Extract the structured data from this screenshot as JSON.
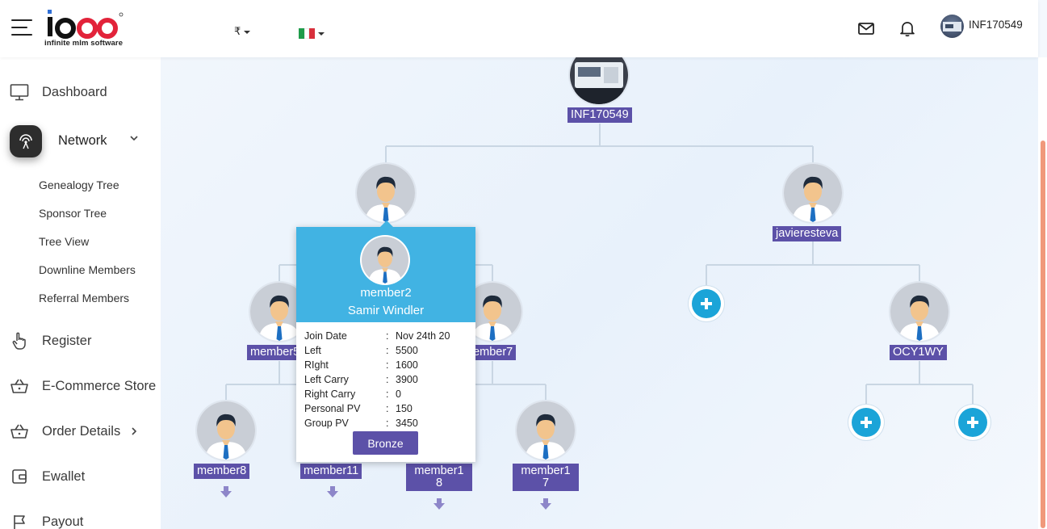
{
  "header": {
    "logo_text": "ioss",
    "logo_tagline": "infinite mlm software",
    "currency_symbol": "₹",
    "language_flag": "italy-flag",
    "mail_icon": "mail-icon",
    "bell_icon": "bell-icon",
    "username": "INF170549"
  },
  "sidebar": {
    "items": [
      {
        "label": "Dashboard",
        "icon": "monitor-icon"
      },
      {
        "label": "Network",
        "icon": "network-icon"
      },
      {
        "label": "Register",
        "icon": "hand-pointer-icon"
      },
      {
        "label": "E-Commerce Store",
        "icon": "basket-icon"
      },
      {
        "label": "Order Details",
        "icon": "basket-icon"
      },
      {
        "label": "Ewallet",
        "icon": "wallet-icon"
      },
      {
        "label": "Payout",
        "icon": "flag-icon"
      }
    ],
    "network_sub": [
      "Genealogy Tree",
      "Sponsor Tree",
      "Tree View",
      "Downline Members",
      "Referral Members"
    ]
  },
  "tree": {
    "root": "INF170549",
    "level1": [
      "member2",
      "javieresteva"
    ],
    "level2": [
      "member5",
      "member7",
      "OCY1WY"
    ],
    "level3": [
      "member8",
      "member11",
      "member1\n8",
      "member1\n7"
    ]
  },
  "tooltip": {
    "username": "member2",
    "full_name": "Samir Windler",
    "rows": [
      {
        "key": "Join Date",
        "value": "Nov 24th 20"
      },
      {
        "key": "Left",
        "value": "5500"
      },
      {
        "key": "RIght",
        "value": "1600"
      },
      {
        "key": "Left Carry",
        "value": "3900"
      },
      {
        "key": "Right Carry",
        "value": "0"
      },
      {
        "key": "Personal PV",
        "value": "150"
      },
      {
        "key": "Group PV",
        "value": "3450"
      }
    ],
    "rank": "Bronze"
  },
  "colors": {
    "tag_bg": "#5c51a8",
    "tooltip_header": "#41b3e3",
    "plus_button": "#1ba4d8",
    "scroll_thumb": "#f0997b"
  }
}
